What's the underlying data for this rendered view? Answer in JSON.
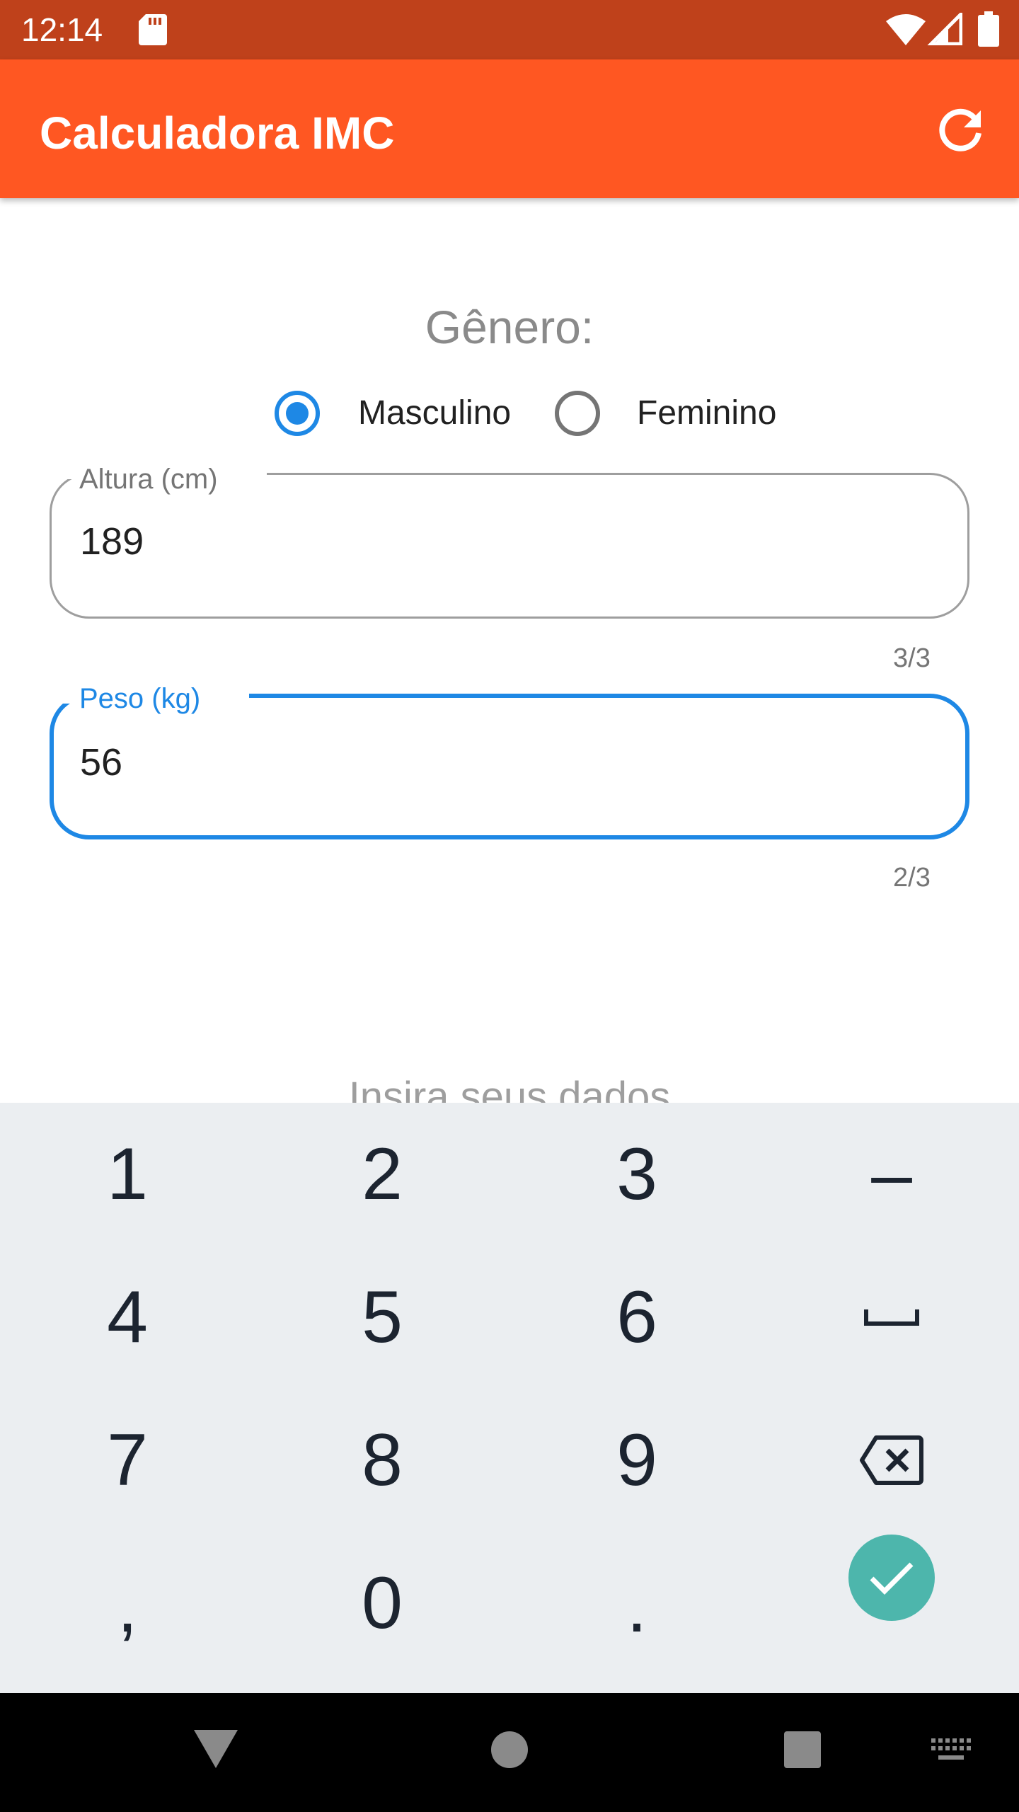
{
  "status_bar": {
    "time": "12:14"
  },
  "app_bar": {
    "title": "Calculadora IMC"
  },
  "form": {
    "gender_label": "Gênero:",
    "gender_options": [
      {
        "label": "Masculino",
        "checked": true
      },
      {
        "label": "Feminino",
        "checked": false
      }
    ],
    "height_field": {
      "label": "Altura (cm)",
      "value": "189",
      "counter": "3/3"
    },
    "weight_field": {
      "label": "Peso (kg)",
      "value": "56",
      "counter": "2/3"
    },
    "hint": "Insira seus dados"
  },
  "keyboard": {
    "keys": [
      "1",
      "2",
      "3",
      "–",
      "4",
      "5",
      "6",
      "7",
      "8",
      "9",
      ",",
      "0",
      "."
    ]
  },
  "colors": {
    "status_bar": "#BF411B",
    "app_bar": "#FF5722",
    "accent": "#1E88E5",
    "enter_key": "#4DB6AC",
    "keyboard_bg": "#EBEEF1"
  }
}
